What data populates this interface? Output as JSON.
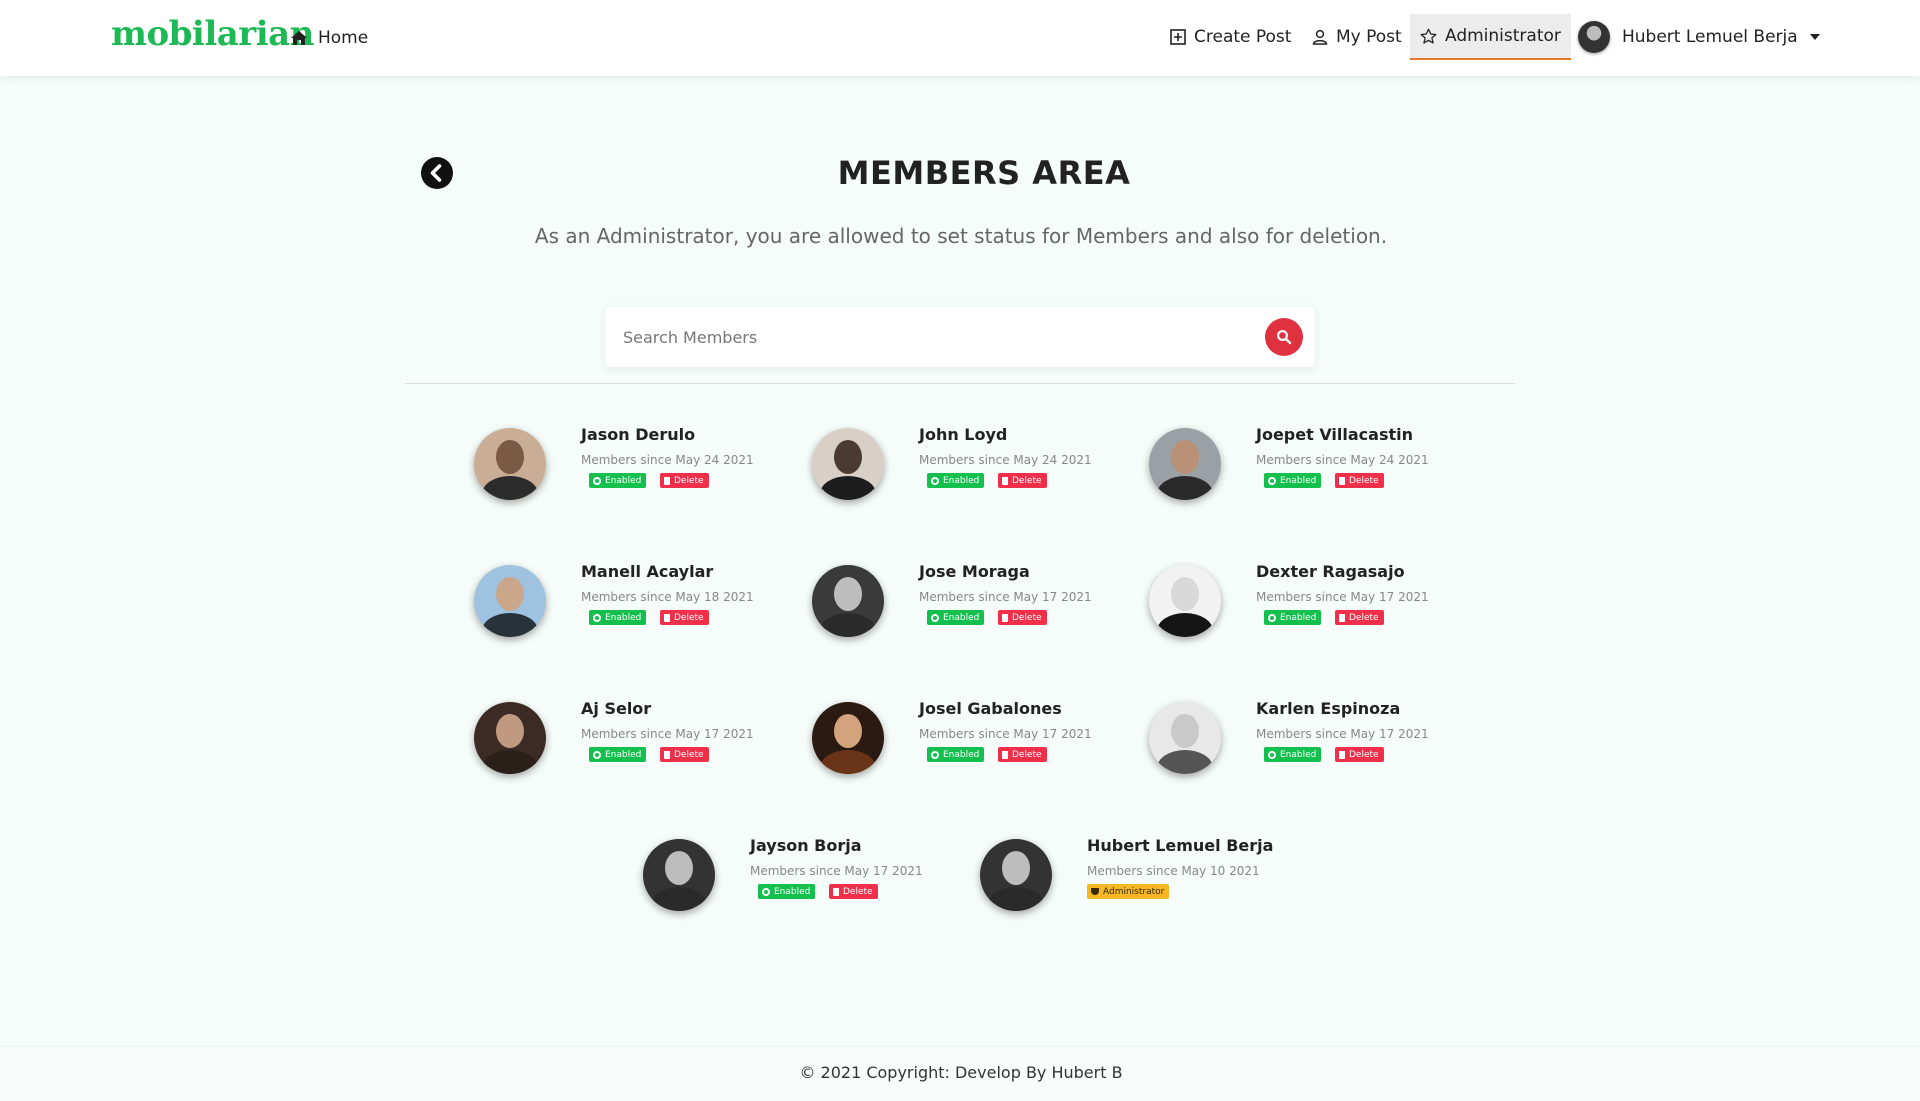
{
  "brand": {
    "name": "mobilarian"
  },
  "nav": {
    "home_label": "Home",
    "create_post_label": "Create Post",
    "my_post_label": "My Post",
    "administrator_label": "Administrator",
    "user_name": "Hubert Lemuel Berja"
  },
  "main": {
    "title": "MEMBERS AREA",
    "subtitle": "As an Administrator, you are allowed to set status for Members and also for deletion.",
    "search_placeholder": "Search Members"
  },
  "badges": {
    "enabled": "Enabled",
    "delete": "Delete",
    "administrator": "Administrator"
  },
  "members": [
    {
      "name": "Jason Derulo",
      "since": "Members since May 24 2021",
      "role": "member"
    },
    {
      "name": "John Loyd",
      "since": "Members since May 24 2021",
      "role": "member"
    },
    {
      "name": "Joepet Villacastin",
      "since": "Members since May 24 2021",
      "role": "member"
    },
    {
      "name": "Manell Acaylar",
      "since": "Members since May 18 2021",
      "role": "member"
    },
    {
      "name": "Jose Moraga",
      "since": "Members since May 17 2021",
      "role": "member"
    },
    {
      "name": "Dexter Ragasajo",
      "since": "Members since May 17 2021",
      "role": "member"
    },
    {
      "name": "Aj Selor",
      "since": "Members since May 17 2021",
      "role": "member"
    },
    {
      "name": "Josel Gabalones",
      "since": "Members since May 17 2021",
      "role": "member"
    },
    {
      "name": "Karlen Espinoza",
      "since": "Members since May 17 2021",
      "role": "member"
    },
    {
      "name": "Jayson Borja",
      "since": "Members since May 17 2021",
      "role": "member"
    },
    {
      "name": "Hubert Lemuel Berja",
      "since": "Members since May 10 2021",
      "role": "administrator"
    }
  ],
  "footer": {
    "text": "© 2021 Copyright: Develop By Hubert B"
  },
  "colors": {
    "brand": "#1db954",
    "enabled": "#13c04d",
    "delete": "#f0304a",
    "admin": "#f5b723",
    "search_button": "#e0313f",
    "active_underline": "#e8772e"
  }
}
